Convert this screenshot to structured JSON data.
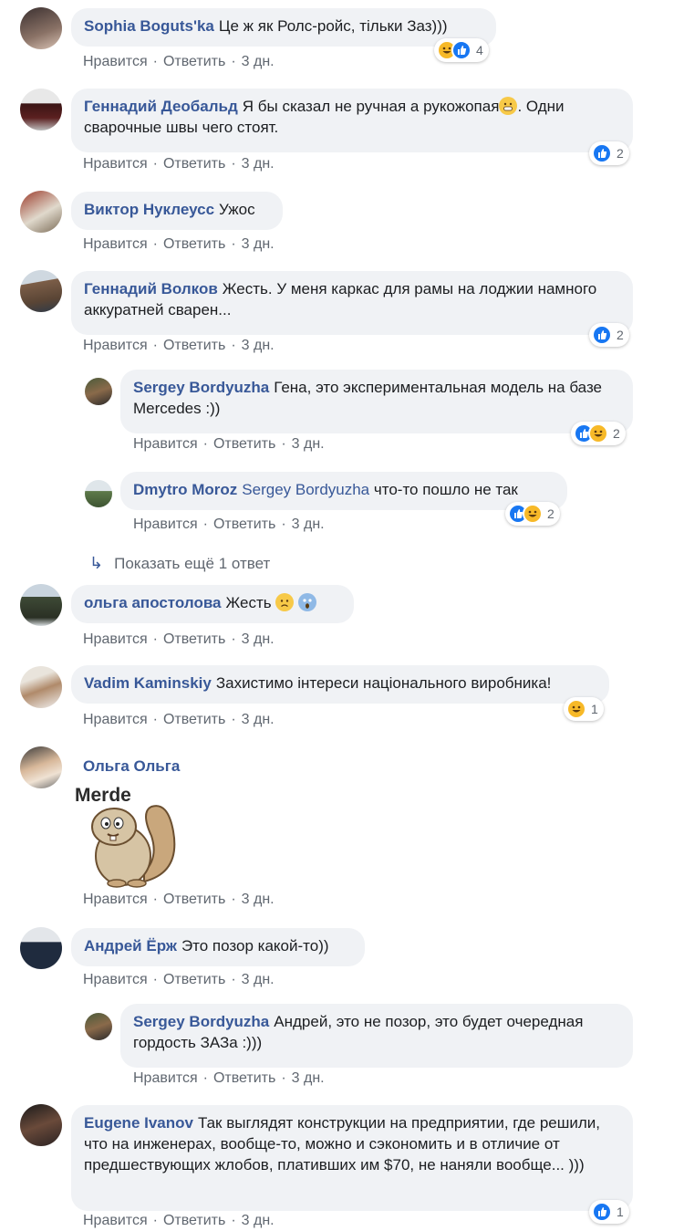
{
  "actions": {
    "like": "Нравится",
    "reply": "Ответить",
    "sep": "·",
    "time": "3 дн."
  },
  "comments": [
    {
      "author": "Sophia Boguts'ka",
      "text": "Це ж як Ролс-ройс, тільки Заз)))",
      "reactions": {
        "icons": [
          "haha-icon",
          "like-icon"
        ],
        "count": "4"
      }
    },
    {
      "author": "Геннадий Деобальд",
      "text": "Я бы сказал не ручная а рукожопая",
      "text2": ". Одни сварочные швы чего стоят.",
      "reactions": {
        "icons": [
          "like-icon"
        ],
        "count": "2"
      }
    },
    {
      "author": "Виктор Нуклеусс",
      "text": "Ужос"
    },
    {
      "author": "Геннадий Волков",
      "text": "Жесть. У меня каркас для рамы на лоджии намного аккуратней сварен...",
      "reactions": {
        "icons": [
          "like-icon"
        ],
        "count": "2"
      }
    },
    {
      "author": "Sergey Bordyuzha",
      "text": "Гена, это экспериментальная модель на базе Mercedes :))",
      "reactions": {
        "icons": [
          "like-icon",
          "haha-icon"
        ],
        "count": "2"
      }
    },
    {
      "author": "Dmytro Moroz",
      "mention": "Sergey Bordyuzha",
      "text": "что-то пошло не так",
      "reactions": {
        "icons": [
          "like-icon",
          "haha-icon"
        ],
        "count": "2"
      }
    },
    {
      "author": "ольга апостолова",
      "text": "Жесть"
    },
    {
      "author": "Vadim Kaminskiy",
      "text": "Захистимо інтереси національного виробника!",
      "reactions": {
        "icons": [
          "haha-icon"
        ],
        "count": "1"
      }
    },
    {
      "author": "Ольга Ольга",
      "sticker_text": "Merde"
    },
    {
      "author": "Андрей Ёрж",
      "text": "Это позор какой-то))"
    },
    {
      "author": "Sergey Bordyuzha",
      "text": "Андрей, это не позор, это будет очередная гордость ЗАЗа :)))"
    },
    {
      "author": "Eugene Ivanov",
      "text": "Так выглядят конструкции на предприятии, где решили, что на инженерах, вообще-то, можно и сэкономить и в отличие от предшествующих жлобов, плативших им $70, не наняли вообще... )))",
      "reactions": {
        "icons": [
          "like-icon"
        ],
        "count": "1"
      }
    }
  ],
  "more_replies": "Показать ещё 1 ответ",
  "colors": {
    "link": "#385898",
    "bubble": "#f0f2f5",
    "like": "#1877f2",
    "haha": "#f7b928",
    "meta": "#606770"
  }
}
